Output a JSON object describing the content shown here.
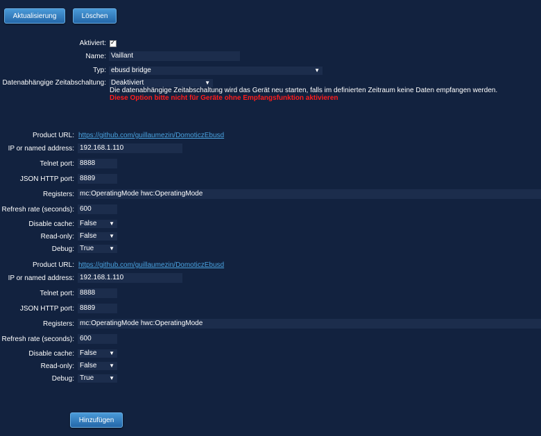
{
  "toolbar": {
    "update_label": "Aktualisierung",
    "delete_label": "Löschen"
  },
  "device": {
    "enabled_label": "Aktiviert:",
    "enabled": true,
    "name_label": "Name:",
    "name_value": "Vaillant",
    "type_label": "Typ:",
    "type_value": "ebusd bridge",
    "timeout_label": "Datenabhängige Zeitabschaltung:",
    "timeout_value": "Deaktiviert",
    "timeout_note": "Die datenabhängige Zeitabschaltung wird das Gerät neu starten, falls im definierten Zeitraum keine Daten empfangen werden.",
    "timeout_warning": "Diese Option bitte nicht für Geräte ohne Empfangsfunktion aktivieren"
  },
  "sections": [
    {
      "product_url_label": "Product URL:",
      "product_url": "https://github.com/guillaumezin/DomoticzEbusd",
      "ip_label": "IP or named address:",
      "ip_value": "192.168.1.110",
      "telnet_label": "Telnet port:",
      "telnet_value": "8888",
      "json_label": "JSON HTTP port:",
      "json_value": "8889",
      "registers_label": "Registers:",
      "registers_value": "mc:OperatingMode hwc:OperatingMode",
      "refresh_label": "Refresh rate (seconds):",
      "refresh_value": "600",
      "cache_label": "Disable cache:",
      "cache_value": "False",
      "readonly_label": "Read-only:",
      "readonly_value": "False",
      "debug_label": "Debug:",
      "debug_value": "True"
    },
    {
      "product_url_label": "Product URL:",
      "product_url": "https://github.com/guillaumezin/DomoticzEbusd",
      "ip_label": "IP or named address:",
      "ip_value": "192.168.1.110",
      "telnet_label": "Telnet port:",
      "telnet_value": "8888",
      "json_label": "JSON HTTP port:",
      "json_value": "8889",
      "registers_label": "Registers:",
      "registers_value": "mc:OperatingMode hwc:OperatingMode",
      "refresh_label": "Refresh rate (seconds):",
      "refresh_value": "600",
      "cache_label": "Disable cache:",
      "cache_value": "False",
      "readonly_label": "Read-only:",
      "readonly_value": "False",
      "debug_label": "Debug:",
      "debug_value": "True"
    }
  ],
  "footer": {
    "add_label": "Hinzufügen"
  },
  "icons": {
    "dropdown": "chevron-down-icon",
    "checkbox": "checkmark-icon"
  },
  "colors": {
    "background": "#12223f",
    "link": "#4aa3e0",
    "warning": "#ff1c1c",
    "button": "#2e7bc4"
  }
}
